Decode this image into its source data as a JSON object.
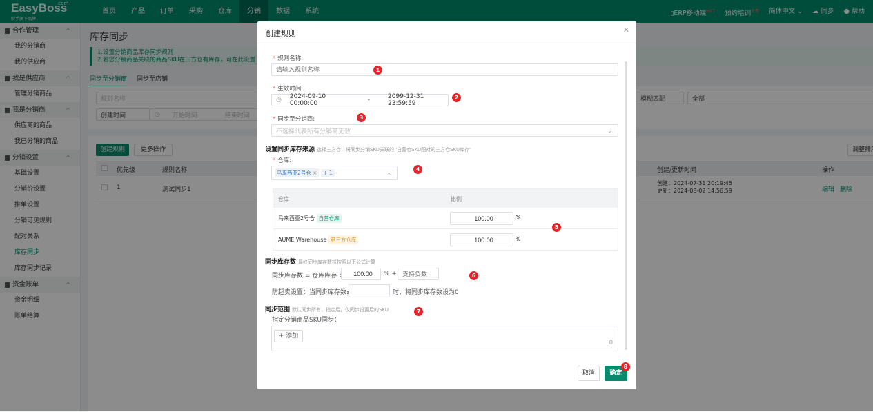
{
  "header": {
    "logo": "EasyBoss",
    "logo_com": ".com",
    "logo_sub": "妙手旗下品牌",
    "nav": [
      "首页",
      "产品",
      "订单",
      "采购",
      "仓库",
      "分销",
      "数据",
      "系统"
    ],
    "active_nav": "分销",
    "right": {
      "erp_mobile": "ERP移动端",
      "erp_badge": "HOT",
      "training": "预约培训",
      "training_badge": "免费",
      "language": "简体中文",
      "sync": "同步",
      "help": "帮助"
    }
  },
  "sidebar": [
    {
      "group": "合作管理",
      "items": [
        "我的分销商",
        "我的供应商"
      ]
    },
    {
      "group": "我是供应商",
      "items": [
        "管理分销商品"
      ]
    },
    {
      "group": "我是分销商",
      "items": [
        "供应商的商品",
        "我已分销的商品"
      ]
    },
    {
      "group": "分销设置",
      "items": [
        "基础设置",
        "分销价设置",
        "推单设置",
        "分销可见规则",
        "配对关系",
        "库存同步",
        "库存同步记录"
      ]
    },
    {
      "group": "资金账单",
      "items": [
        "资金明细",
        "账单结算"
      ]
    }
  ],
  "active_item": "库存同步",
  "page": {
    "title": "库存同步",
    "notice": [
      "1.设置分销商品库存同步规则",
      "2.若您分销商品关联的商品SKU在三方仓有库存，可在此设置"
    ],
    "tabs": [
      "同步至分销商",
      "同步至店铺"
    ],
    "filters": {
      "rule_name_placeholder": "规则名称",
      "time_type": "创建时间",
      "start_placeholder": "开始时间",
      "end_placeholder": "结束时间",
      "match": "模糊匹配",
      "all": "全部"
    },
    "create_button": "创建规则",
    "more_button": "更多操作",
    "sort_button": "调整排序",
    "table": {
      "headers": [
        "优先级",
        "规则名称",
        "创建/更新时间",
        "操作"
      ],
      "rows": [
        {
          "priority": "1",
          "name": "测试同步1",
          "created": "创建：2024-07-31 20:19:45",
          "updated": "更新：2024-08-02 14:56:59",
          "edit": "编辑",
          "delete": "删除"
        }
      ]
    }
  },
  "modal": {
    "title": "创建规则",
    "rule_name_label": "规则名称:",
    "rule_name_placeholder": "请输入规则名称",
    "effective_label": "生效时间:",
    "start": "2024-09-10 00:00:00",
    "sep": "-",
    "end": "2099-12-31 23:59:59",
    "distributor_label": "同步至分销商:",
    "distributor_placeholder": "不选择代表所有分销商无效",
    "source_title": "设置同步库存来源",
    "source_hint": "选择三方仓，将同步分销SKU关联的 '自营仓SKU配对的三方仓SKU库存'",
    "warehouse_label": "仓库:",
    "warehouse_tag": "马来西亚2号仓",
    "warehouse_more": "+ 1",
    "wh_table": {
      "headers": [
        "仓库",
        "比例"
      ],
      "rows": [
        {
          "name": "马来西亚2号仓",
          "tag": "自营仓库",
          "ratio": "100.00",
          "unit": "%"
        },
        {
          "name": "AUME Warehouse",
          "tag": "第三方仓库",
          "ratio": "100.00",
          "unit": "%"
        }
      ]
    },
    "qty_title": "同步库存数",
    "qty_hint": "最终同步库存数将按照以下公式计算",
    "formula_prefix": "同步库存数 = 仓库库存 ×",
    "formula_ratio": "100.00",
    "formula_mid": "% +",
    "formula_placeholder": "支持负数",
    "oversell_prefix": "防超卖设置：当同步库存数≤",
    "oversell_suffix": "时，将同步库存数设为0",
    "scope_title": "同步范围",
    "scope_hint": "默认同步所有，指定后，仅同步设置后的SKU",
    "scope_label": "指定分销商品SKU同步：",
    "add_button": "+ 添加",
    "count": "0",
    "cancel": "取消",
    "confirm": "确定"
  },
  "badges": [
    "1",
    "2",
    "3",
    "4",
    "5",
    "6",
    "7",
    "8"
  ],
  "colors": {
    "brand": "#008c6e",
    "badge": "#e8242a"
  }
}
